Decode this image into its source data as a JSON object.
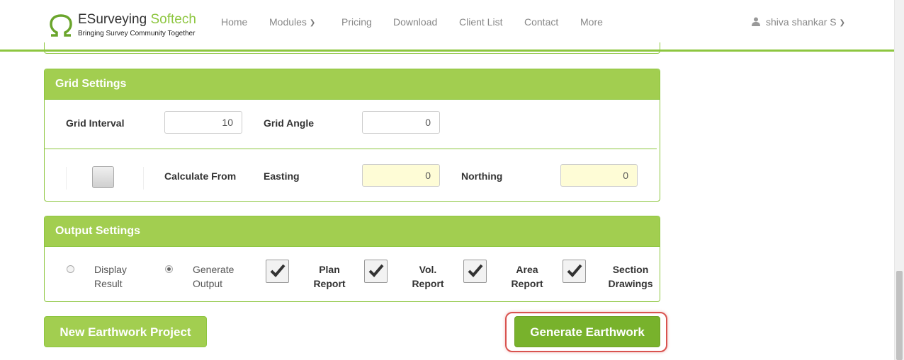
{
  "brand": {
    "title_main": "ESurveying",
    "title_accent": "Softech",
    "tagline": "Bringing Survey Community Together",
    "accent_color": "#8dc63f"
  },
  "nav": {
    "home": "Home",
    "modules": "Modules",
    "pricing": "Pricing",
    "download": "Download",
    "client_list": "Client List",
    "contact": "Contact",
    "more": "More",
    "user": "shiva shankar S"
  },
  "grid_settings": {
    "title": "Grid Settings",
    "grid_interval_label": "Grid Interval",
    "grid_interval_value": "10",
    "grid_angle_label": "Grid Angle",
    "grid_angle_value": "0",
    "calculate_from_label": "Calculate From",
    "easting_label": "Easting",
    "easting_value": "0",
    "northing_label": "Northing",
    "northing_value": "0"
  },
  "output_settings": {
    "title": "Output Settings",
    "radio_display": [
      "Display",
      "Result"
    ],
    "radio_generate": [
      "Generate",
      "Output"
    ],
    "selected_radio": "generate",
    "check_plan": [
      "Plan",
      "Report"
    ],
    "check_vol": [
      "Vol.",
      "Report"
    ],
    "check_area": [
      "Area",
      "Report"
    ],
    "check_section": [
      "Section",
      "Drawings"
    ]
  },
  "buttons": {
    "new_project": "New Earthwork Project",
    "generate": "Generate Earthwork"
  }
}
